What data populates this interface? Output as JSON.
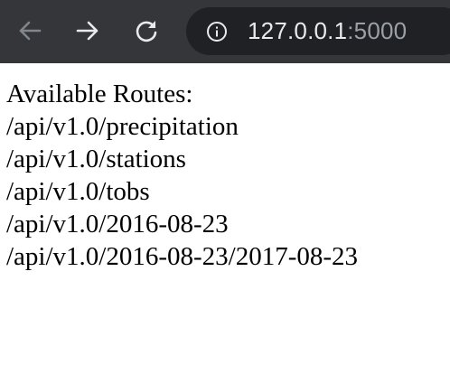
{
  "browser": {
    "url_host": "127.0.0.1",
    "url_port": ":5000",
    "icons": {
      "back": "arrow-left-icon",
      "forward": "arrow-right-icon",
      "reload": "reload-icon",
      "site_info": "info-icon"
    },
    "colors": {
      "toolbar": "#35363a",
      "omnibox": "#202124",
      "host_text": "#e8eaed",
      "port_text": "#9aa0a6",
      "back_disabled": "#80868b",
      "icon_active": "#e8eaed"
    }
  },
  "page": {
    "heading": "Available Routes:",
    "routes": [
      "/api/v1.0/precipitation",
      "/api/v1.0/stations",
      "/api/v1.0/tobs",
      "/api/v1.0/2016-08-23",
      "/api/v1.0/2016-08-23/2017-08-23"
    ]
  }
}
